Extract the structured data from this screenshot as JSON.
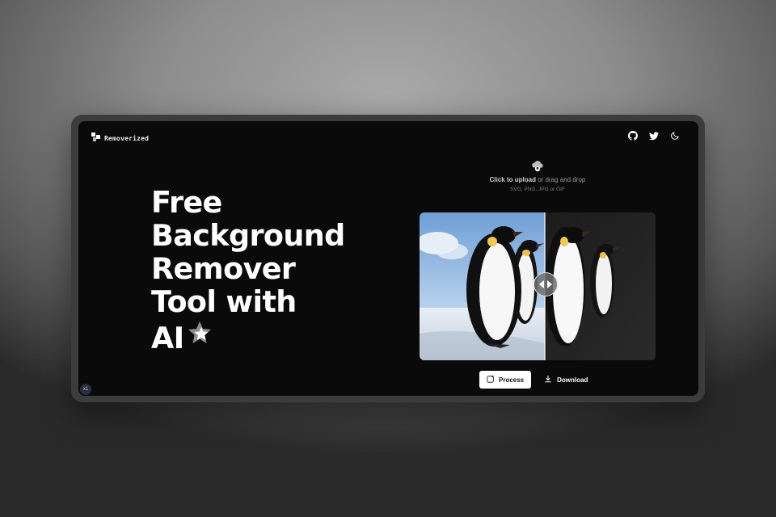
{
  "brand": {
    "name": "Removerized"
  },
  "nav": {
    "icons": [
      "github-icon",
      "twitter-icon",
      "moon-icon"
    ]
  },
  "hero": {
    "lines": [
      "Free",
      "Background",
      "Remover",
      "Tool with",
      "AI"
    ]
  },
  "upload": {
    "click_label": "Click to upload",
    "drag_label": "or drag and drop",
    "formats": "SVG, PNG, JPG or GIF"
  },
  "actions": {
    "process_label": "Process",
    "download_label": "Download"
  },
  "badge": {
    "label": "x1"
  },
  "colors": {
    "screen_bg": "#0a0a0a",
    "frame": "#3c3c3c",
    "accent": "#ffffff"
  }
}
